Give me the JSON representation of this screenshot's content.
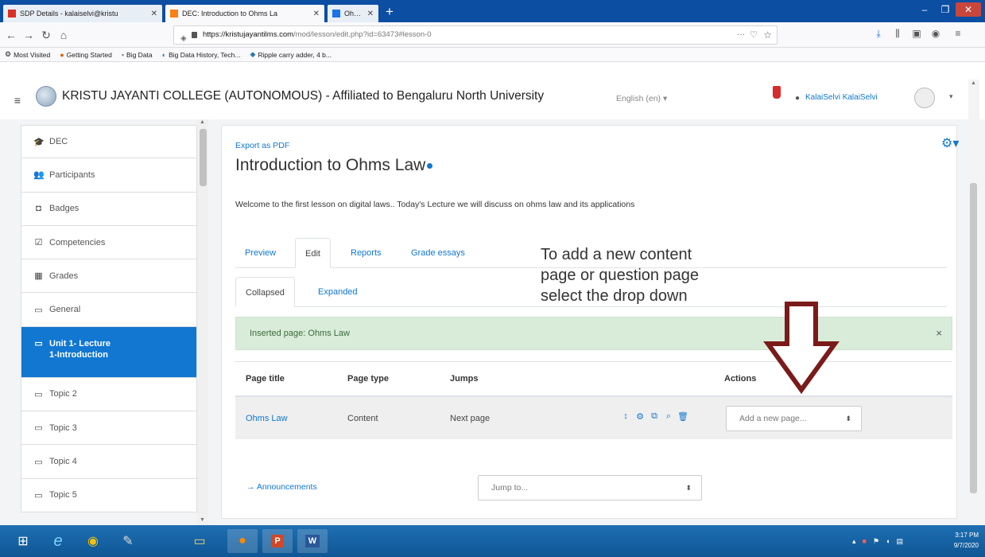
{
  "browser": {
    "tabs": [
      {
        "title": "SDP Details - kalaiselvi@kristu",
        "favicon": "gmail-icon",
        "color": "#d93025",
        "active": false
      },
      {
        "title": "DEC: Introduction to Ohms La",
        "favicon": "moodle-icon",
        "color": "#f98012",
        "active": true
      },
      {
        "title": "Ohm's Law - How Voltage, Cu",
        "favicon": "page-icon",
        "color": "#1a73e8",
        "active": false
      }
    ],
    "url_host": "https://kristujayantilms.com",
    "url_path": "/mod/lesson/edit.php?id=63473#lesson-0",
    "bookmarks": [
      "Most Visited",
      "Getting Started",
      "Big Data",
      "Big Data History, Tech...",
      "Ripple carry adder, 4 b..."
    ]
  },
  "header": {
    "site_title": "KRISTU JAYANTI COLLEGE (AUTONOMOUS) - Affiliated to Bengaluru North University",
    "language": "English (en) ▾",
    "user_name": "KalaiSelvi KalaiSelvi"
  },
  "sidebar": {
    "items": [
      {
        "label": "DEC",
        "icon": "graduation-cap-icon",
        "glyph": "🎓",
        "active": false
      },
      {
        "label": "Participants",
        "icon": "users-icon",
        "glyph": "👥",
        "active": false
      },
      {
        "label": "Badges",
        "icon": "shield-icon",
        "glyph": "◘",
        "active": false
      },
      {
        "label": "Competencies",
        "icon": "checkbox-icon",
        "glyph": "☑",
        "active": false
      },
      {
        "label": "Grades",
        "icon": "table-icon",
        "glyph": "▦",
        "active": false
      },
      {
        "label": "General",
        "icon": "folder-icon",
        "glyph": "▭",
        "active": false
      },
      {
        "label": "Unit 1- Lecture\n1-Introduction",
        "icon": "folder-icon",
        "glyph": "▭",
        "active": true
      },
      {
        "label": "Topic 2",
        "icon": "folder-icon",
        "glyph": "▭",
        "active": false
      },
      {
        "label": "Topic 3",
        "icon": "folder-icon",
        "glyph": "▭",
        "active": false
      },
      {
        "label": "Topic 4",
        "icon": "folder-icon",
        "glyph": "▭",
        "active": false
      },
      {
        "label": "Topic 5",
        "icon": "folder-icon",
        "glyph": "▭",
        "active": false
      }
    ]
  },
  "main": {
    "export_link": "Export as PDF",
    "heading": "Introduction to Ohms Law",
    "intro": "Welcome to the first lesson on digital laws.. Today's Lecture we will discuss on ohms law and its applications",
    "tabs": [
      "Preview",
      "Edit",
      "Reports",
      "Grade essays"
    ],
    "active_tab": "Edit",
    "view_tabs": [
      "Collapsed",
      "Expanded"
    ],
    "active_view": "Collapsed",
    "alert": "Inserted page: Ohms Law",
    "table": {
      "headers": [
        "Page title",
        "Page type",
        "Jumps",
        "Actions"
      ],
      "rows": [
        {
          "title": "Ohms Law",
          "type": "Content",
          "jump": "Next page"
        }
      ],
      "add_page_placeholder": "Add a new page..."
    },
    "announcements_link": "→ Announcements",
    "jump_to": "Jump to..."
  },
  "annotation": {
    "lines": [
      "To add a new content",
      "page or question page",
      "select the drop down"
    ],
    "arrow_color": "#7a1a1a"
  },
  "taskbar": {
    "time": "3:17 PM",
    "date": "9/7/2020"
  }
}
